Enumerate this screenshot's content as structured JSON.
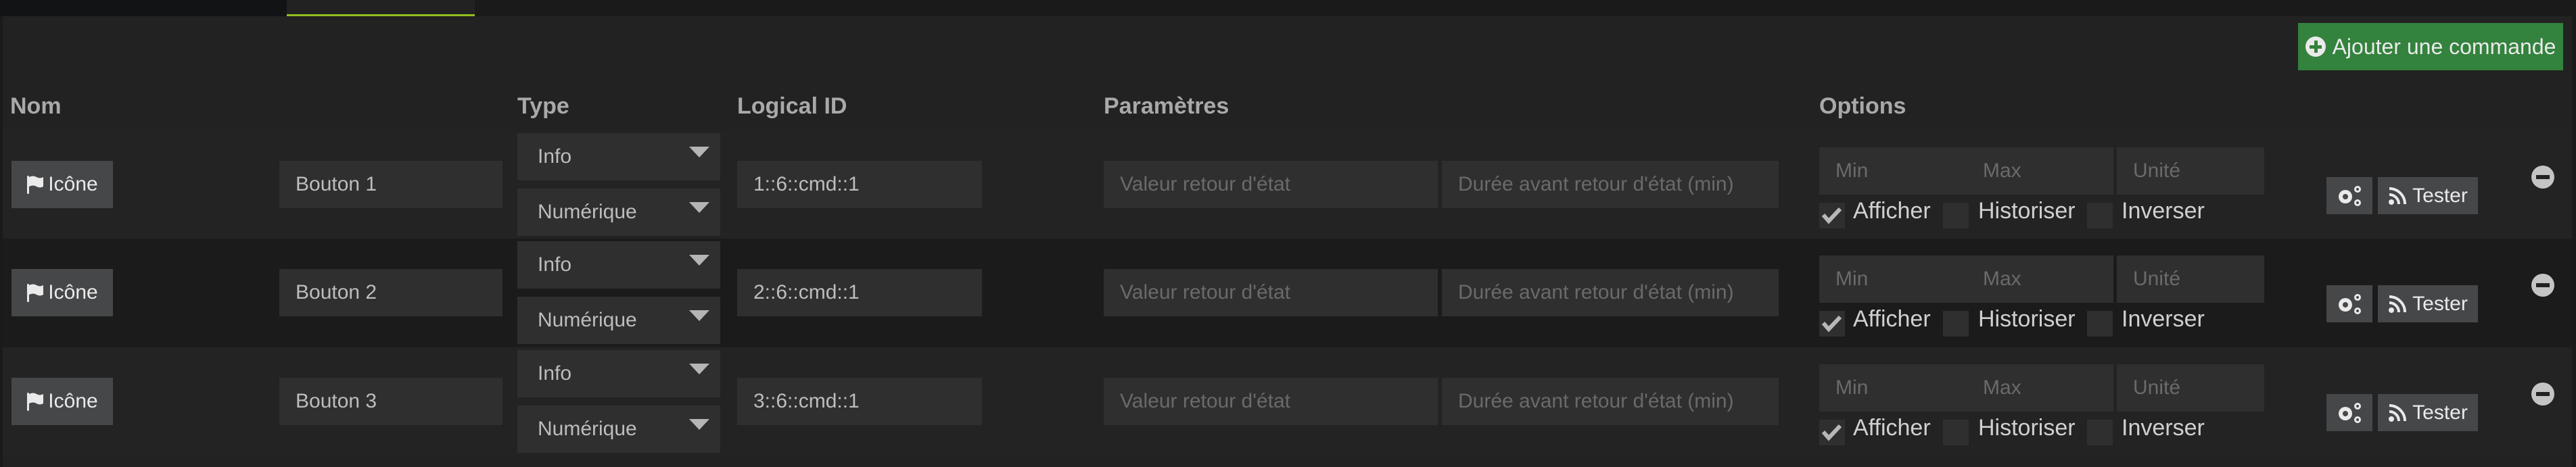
{
  "colors": {
    "accent_tab": "#93c01f",
    "add_button": "#33823d"
  },
  "toolbar": {
    "add_command_label": "Ajouter une commande",
    "add_icon": "plus-circle-icon"
  },
  "table": {
    "headers": {
      "nom": "Nom",
      "type": "Type",
      "logical_id": "Logical ID",
      "parametres": "Paramètres",
      "options": "Options"
    },
    "rows": [
      {
        "icon_button": "Icône",
        "name": "Bouton 1",
        "type": "Info",
        "subtype": "Numérique",
        "logical_id": "1::6::cmd::1",
        "param1_placeholder": "Valeur retour d'état",
        "param2_placeholder": "Durée avant retour d'état (min)",
        "min_placeholder": "Min",
        "max_placeholder": "Max",
        "unit_placeholder": "Unité",
        "afficher": "Afficher",
        "afficher_checked": true,
        "historiser": "Historiser",
        "historiser_checked": false,
        "inverser": "Inverser",
        "inverser_checked": false,
        "test_label": "Tester"
      },
      {
        "icon_button": "Icône",
        "name": "Bouton 2",
        "type": "Info",
        "subtype": "Numérique",
        "logical_id": "2::6::cmd::1",
        "param1_placeholder": "Valeur retour d'état",
        "param2_placeholder": "Durée avant retour d'état (min)",
        "min_placeholder": "Min",
        "max_placeholder": "Max",
        "unit_placeholder": "Unité",
        "afficher": "Afficher",
        "afficher_checked": true,
        "historiser": "Historiser",
        "historiser_checked": false,
        "inverser": "Inverser",
        "inverser_checked": false,
        "test_label": "Tester"
      },
      {
        "icon_button": "Icône",
        "name": "Bouton 3",
        "type": "Info",
        "subtype": "Numérique",
        "logical_id": "3::6::cmd::1",
        "param1_placeholder": "Valeur retour d'état",
        "param2_placeholder": "Durée avant retour d'état (min)",
        "min_placeholder": "Min",
        "max_placeholder": "Max",
        "unit_placeholder": "Unité",
        "afficher": "Afficher",
        "afficher_checked": true,
        "historiser": "Historiser",
        "historiser_checked": false,
        "inverser": "Inverser",
        "inverser_checked": false,
        "test_label": "Tester"
      }
    ]
  }
}
